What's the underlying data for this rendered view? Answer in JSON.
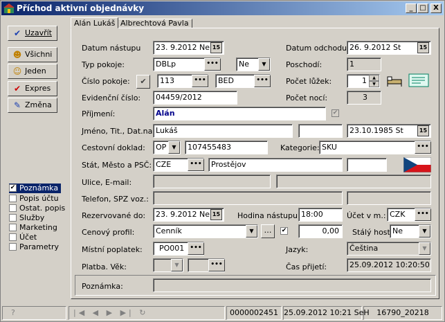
{
  "window": {
    "title": "Příchod aktivní objednávky",
    "min": "_",
    "max": "□",
    "close": "X"
  },
  "tabs": [
    {
      "label": "Alán Lukáš"
    },
    {
      "label": "Albrechtová Pavla"
    }
  ],
  "left_buttons": [
    {
      "label": "Uzavřít",
      "icon": "check-blue-icon"
    },
    {
      "label": "Všichni",
      "icon": "people-icon"
    },
    {
      "label": "Jeden",
      "icon": "person-icon"
    },
    {
      "label": "Expres",
      "icon": "double-check-icon"
    },
    {
      "label": "Změna",
      "icon": "edit-icon"
    }
  ],
  "left_checks": [
    {
      "label": "Poznámka",
      "checked": true
    },
    {
      "label": "Popis účtu",
      "checked": false
    },
    {
      "label": "Ostat. popis",
      "checked": false
    },
    {
      "label": "Služby",
      "checked": false
    },
    {
      "label": "Marketing",
      "checked": false
    },
    {
      "label": "Účet",
      "checked": false
    },
    {
      "label": "Parametry",
      "checked": false
    }
  ],
  "labels": {
    "datum_nastupu": "Datum nástupu",
    "typ_pokoje": "Typ pokoje:",
    "cislo_pokoje": "Číslo pokoje:",
    "evidencni_cislo": "Evidenční číslo:",
    "prijmeni": "Příjmení:",
    "jmeno": "Jméno, Tit., Dat.nar.:",
    "cestovni_doklad": "Cestovní doklad:",
    "stat": "Stát, Město a PSČ:",
    "ulice": "Ulice, E-mail:",
    "telefon": "Telefon, SPZ voz.:",
    "rezervovane_do": "Rezervované do:",
    "cenovy_profil": "Cenový profil:",
    "mistni_poplatek": "Místní poplatek:",
    "platba_vek": "Platba. Věk:",
    "poznamka": "Poznámka:",
    "datum_odchodu": "Datum odchodu:",
    "poschodi": "Poschodí:",
    "pocet_luzek": "Počet lůžek:",
    "pocet_noci": "Počet nocí:",
    "kategorie": "Kategorie:",
    "hodina_nastupu": "Hodina nástupu:",
    "ucet_v_m": "Účet v m.:",
    "staly_host": "Stálý host:",
    "jazyk": "Jazyk:",
    "cas_prijeti": "Čas přijetí:"
  },
  "values": {
    "datum_nastupu": "23. 9.2012  Ne",
    "datum_odchodu": "26. 9.2012  St",
    "typ_pokoje": "DBLp",
    "typ_pokoje_ne": "Ne",
    "poschodi": "1",
    "cislo_pokoje": "113",
    "cislo_pokoje_typ": "BED",
    "pocet_luzek": "1",
    "evidencni_cislo": "04459/2012",
    "pocet_noci": "3",
    "prijmeni": "Alán",
    "jmeno": "Lukáš",
    "datum_narozeni": "23.10.1985  St",
    "doklad_typ": "OP",
    "doklad_cislo": "107455483",
    "kategorie": "SKU",
    "stat": "CZE",
    "mesto": "Prostějov",
    "rezervovane_do": "23. 9.2012  Ne",
    "hodina_nastupu": "18:00",
    "ucet_mena": "CZK",
    "cenovy_profil": "Cenník",
    "cena": "0,00",
    "staly_host": "Ne",
    "mistni_poplatek": "PO001",
    "jazyk": "Čeština",
    "cas_prijeti": "25.09.2012 10:20:50"
  },
  "status": {
    "record": "0000002451",
    "datetime": "25.09.2012 10:21 SeH",
    "code": "16790_20218"
  },
  "colors": {
    "title_start": "#0a246a",
    "title_end": "#a6caf0",
    "prijmeni_text": "#00008b"
  }
}
